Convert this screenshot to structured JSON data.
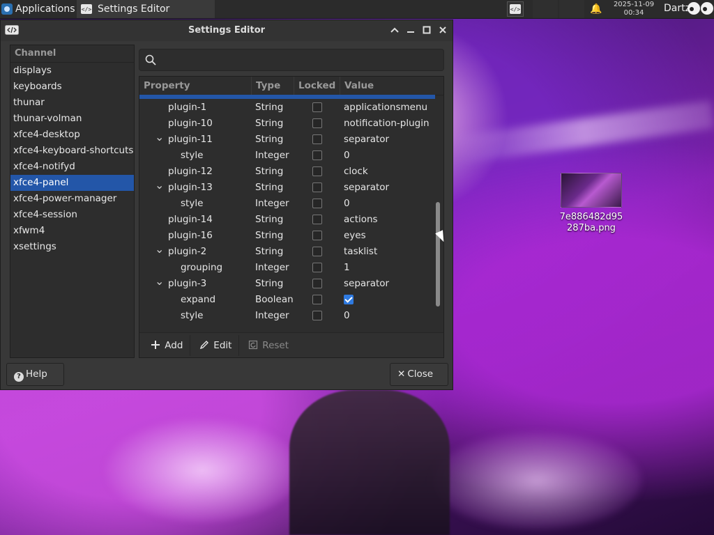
{
  "panel": {
    "apps_label": "Applications",
    "task_label": "Settings Editor",
    "clock_date": "2025-11-09",
    "clock_time": "00:34",
    "user": "Dartz"
  },
  "desktop": {
    "file_label": "7e886482d95\n287ba.png"
  },
  "window": {
    "title": "Settings Editor",
    "channel_header": "Channel",
    "channels": [
      "displays",
      "keyboards",
      "thunar",
      "thunar-volman",
      "xfce4-desktop",
      "xfce4-keyboard-shortcuts",
      "xfce4-notifyd",
      "xfce4-panel",
      "xfce4-power-manager",
      "xfce4-session",
      "xfwm4",
      "xsettings"
    ],
    "selected_channel": "xfce4-panel",
    "columns": [
      "Property",
      "Type",
      "Locked",
      "Value"
    ],
    "rows": [
      {
        "name": "plugin-1",
        "type": "String",
        "value": "applicationsmenu",
        "indent": 1,
        "expand": false,
        "bool": false
      },
      {
        "name": "plugin-10",
        "type": "String",
        "value": "notification-plugin",
        "indent": 1,
        "expand": false,
        "bool": false
      },
      {
        "name": "plugin-11",
        "type": "String",
        "value": "separator",
        "indent": 1,
        "expand": true,
        "bool": false
      },
      {
        "name": "style",
        "type": "Integer",
        "value": "0",
        "indent": 2,
        "expand": false,
        "bool": false
      },
      {
        "name": "plugin-12",
        "type": "String",
        "value": "clock",
        "indent": 1,
        "expand": false,
        "bool": false
      },
      {
        "name": "plugin-13",
        "type": "String",
        "value": "separator",
        "indent": 1,
        "expand": true,
        "bool": false
      },
      {
        "name": "style",
        "type": "Integer",
        "value": "0",
        "indent": 2,
        "expand": false,
        "bool": false
      },
      {
        "name": "plugin-14",
        "type": "String",
        "value": "actions",
        "indent": 1,
        "expand": false,
        "bool": false
      },
      {
        "name": "plugin-16",
        "type": "String",
        "value": "eyes",
        "indent": 1,
        "expand": false,
        "bool": false
      },
      {
        "name": "plugin-2",
        "type": "String",
        "value": "tasklist",
        "indent": 1,
        "expand": true,
        "bool": false
      },
      {
        "name": "grouping",
        "type": "Integer",
        "value": "1",
        "indent": 2,
        "expand": false,
        "bool": false
      },
      {
        "name": "plugin-3",
        "type": "String",
        "value": "separator",
        "indent": 1,
        "expand": true,
        "bool": false
      },
      {
        "name": "expand",
        "type": "Boolean",
        "value": "",
        "indent": 2,
        "expand": false,
        "bool": true
      },
      {
        "name": "style",
        "type": "Integer",
        "value": "0",
        "indent": 2,
        "expand": false,
        "bool": false
      }
    ],
    "toolbar": {
      "add": "Add",
      "edit": "Edit",
      "reset": "Reset"
    },
    "help_label": "Help",
    "close_label": "Close"
  },
  "colors": {
    "selection": "#2356a8",
    "window_bg": "#383838",
    "checkbox_checked": "#2f7ae0"
  },
  "icons": [
    "search-icon",
    "chevron-down-icon",
    "help-icon",
    "close-icon",
    "edit-icon",
    "add-icon",
    "reset-icon",
    "bell-icon",
    "code-icon"
  ]
}
